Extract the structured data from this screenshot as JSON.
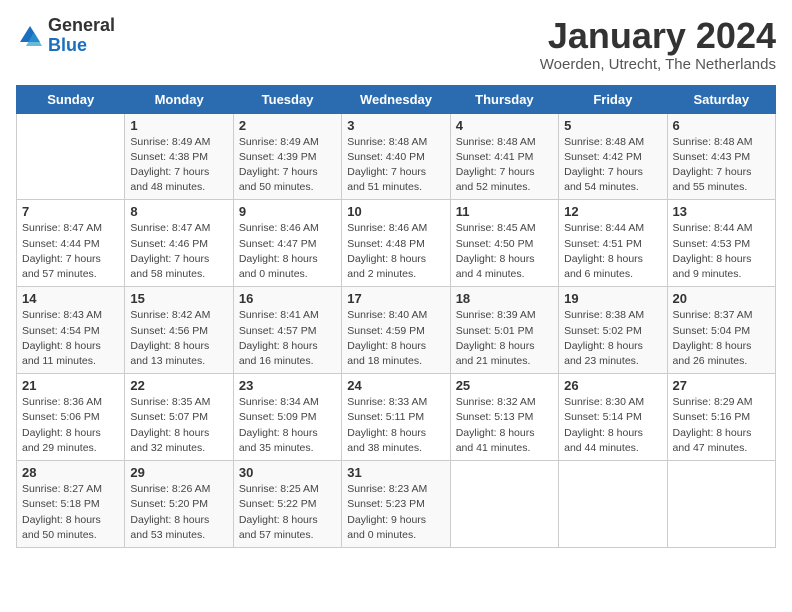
{
  "logo": {
    "general": "General",
    "blue": "Blue"
  },
  "title": "January 2024",
  "subtitle": "Woerden, Utrecht, The Netherlands",
  "days_of_week": [
    "Sunday",
    "Monday",
    "Tuesday",
    "Wednesday",
    "Thursday",
    "Friday",
    "Saturday"
  ],
  "weeks": [
    [
      {
        "day": "",
        "info": ""
      },
      {
        "day": "1",
        "info": "Sunrise: 8:49 AM\nSunset: 4:38 PM\nDaylight: 7 hours\nand 48 minutes."
      },
      {
        "day": "2",
        "info": "Sunrise: 8:49 AM\nSunset: 4:39 PM\nDaylight: 7 hours\nand 50 minutes."
      },
      {
        "day": "3",
        "info": "Sunrise: 8:48 AM\nSunset: 4:40 PM\nDaylight: 7 hours\nand 51 minutes."
      },
      {
        "day": "4",
        "info": "Sunrise: 8:48 AM\nSunset: 4:41 PM\nDaylight: 7 hours\nand 52 minutes."
      },
      {
        "day": "5",
        "info": "Sunrise: 8:48 AM\nSunset: 4:42 PM\nDaylight: 7 hours\nand 54 minutes."
      },
      {
        "day": "6",
        "info": "Sunrise: 8:48 AM\nSunset: 4:43 PM\nDaylight: 7 hours\nand 55 minutes."
      }
    ],
    [
      {
        "day": "7",
        "info": "Sunrise: 8:47 AM\nSunset: 4:44 PM\nDaylight: 7 hours\nand 57 minutes."
      },
      {
        "day": "8",
        "info": "Sunrise: 8:47 AM\nSunset: 4:46 PM\nDaylight: 7 hours\nand 58 minutes."
      },
      {
        "day": "9",
        "info": "Sunrise: 8:46 AM\nSunset: 4:47 PM\nDaylight: 8 hours\nand 0 minutes."
      },
      {
        "day": "10",
        "info": "Sunrise: 8:46 AM\nSunset: 4:48 PM\nDaylight: 8 hours\nand 2 minutes."
      },
      {
        "day": "11",
        "info": "Sunrise: 8:45 AM\nSunset: 4:50 PM\nDaylight: 8 hours\nand 4 minutes."
      },
      {
        "day": "12",
        "info": "Sunrise: 8:44 AM\nSunset: 4:51 PM\nDaylight: 8 hours\nand 6 minutes."
      },
      {
        "day": "13",
        "info": "Sunrise: 8:44 AM\nSunset: 4:53 PM\nDaylight: 8 hours\nand 9 minutes."
      }
    ],
    [
      {
        "day": "14",
        "info": "Sunrise: 8:43 AM\nSunset: 4:54 PM\nDaylight: 8 hours\nand 11 minutes."
      },
      {
        "day": "15",
        "info": "Sunrise: 8:42 AM\nSunset: 4:56 PM\nDaylight: 8 hours\nand 13 minutes."
      },
      {
        "day": "16",
        "info": "Sunrise: 8:41 AM\nSunset: 4:57 PM\nDaylight: 8 hours\nand 16 minutes."
      },
      {
        "day": "17",
        "info": "Sunrise: 8:40 AM\nSunset: 4:59 PM\nDaylight: 8 hours\nand 18 minutes."
      },
      {
        "day": "18",
        "info": "Sunrise: 8:39 AM\nSunset: 5:01 PM\nDaylight: 8 hours\nand 21 minutes."
      },
      {
        "day": "19",
        "info": "Sunrise: 8:38 AM\nSunset: 5:02 PM\nDaylight: 8 hours\nand 23 minutes."
      },
      {
        "day": "20",
        "info": "Sunrise: 8:37 AM\nSunset: 5:04 PM\nDaylight: 8 hours\nand 26 minutes."
      }
    ],
    [
      {
        "day": "21",
        "info": "Sunrise: 8:36 AM\nSunset: 5:06 PM\nDaylight: 8 hours\nand 29 minutes."
      },
      {
        "day": "22",
        "info": "Sunrise: 8:35 AM\nSunset: 5:07 PM\nDaylight: 8 hours\nand 32 minutes."
      },
      {
        "day": "23",
        "info": "Sunrise: 8:34 AM\nSunset: 5:09 PM\nDaylight: 8 hours\nand 35 minutes."
      },
      {
        "day": "24",
        "info": "Sunrise: 8:33 AM\nSunset: 5:11 PM\nDaylight: 8 hours\nand 38 minutes."
      },
      {
        "day": "25",
        "info": "Sunrise: 8:32 AM\nSunset: 5:13 PM\nDaylight: 8 hours\nand 41 minutes."
      },
      {
        "day": "26",
        "info": "Sunrise: 8:30 AM\nSunset: 5:14 PM\nDaylight: 8 hours\nand 44 minutes."
      },
      {
        "day": "27",
        "info": "Sunrise: 8:29 AM\nSunset: 5:16 PM\nDaylight: 8 hours\nand 47 minutes."
      }
    ],
    [
      {
        "day": "28",
        "info": "Sunrise: 8:27 AM\nSunset: 5:18 PM\nDaylight: 8 hours\nand 50 minutes."
      },
      {
        "day": "29",
        "info": "Sunrise: 8:26 AM\nSunset: 5:20 PM\nDaylight: 8 hours\nand 53 minutes."
      },
      {
        "day": "30",
        "info": "Sunrise: 8:25 AM\nSunset: 5:22 PM\nDaylight: 8 hours\nand 57 minutes."
      },
      {
        "day": "31",
        "info": "Sunrise: 8:23 AM\nSunset: 5:23 PM\nDaylight: 9 hours\nand 0 minutes."
      },
      {
        "day": "",
        "info": ""
      },
      {
        "day": "",
        "info": ""
      },
      {
        "day": "",
        "info": ""
      }
    ]
  ]
}
